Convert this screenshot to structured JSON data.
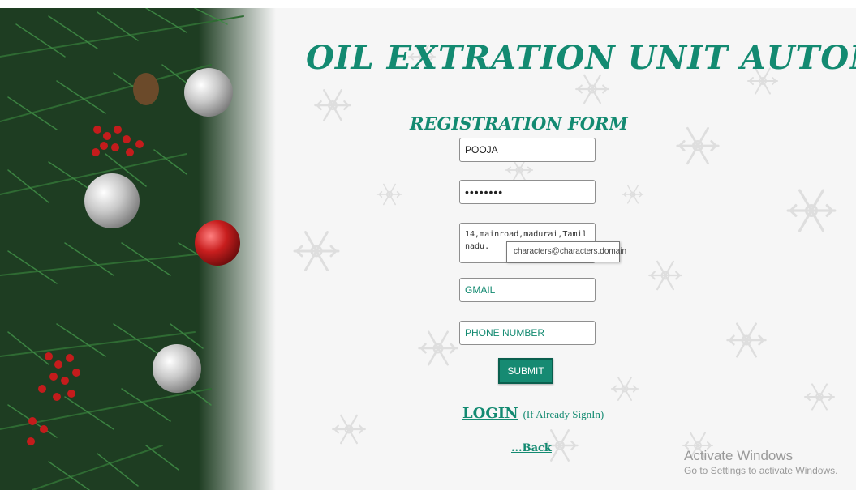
{
  "header": {
    "title": "OIL EXTRATION UNIT AUTOMATION",
    "subtitle": "REGISTRATION FORM"
  },
  "form": {
    "username_value": "POOJA",
    "password_value": "••••••••",
    "address_value": "14,mainroad,madurai,Tamil nadu.",
    "email_placeholder": "GMAIL",
    "phone_placeholder": "PHONE NUMBER",
    "email_format_tooltip": "characters@characters.domain",
    "submit_label": "SUBMIT"
  },
  "links": {
    "login_label": "LOGIN",
    "login_note": "(If Already SignIn)",
    "back_label": "...Back"
  },
  "watermark": {
    "title": "Activate Windows",
    "subtitle": "Go to Settings to activate Windows."
  },
  "colors": {
    "accent": "#138a71",
    "button": "#168a72"
  }
}
